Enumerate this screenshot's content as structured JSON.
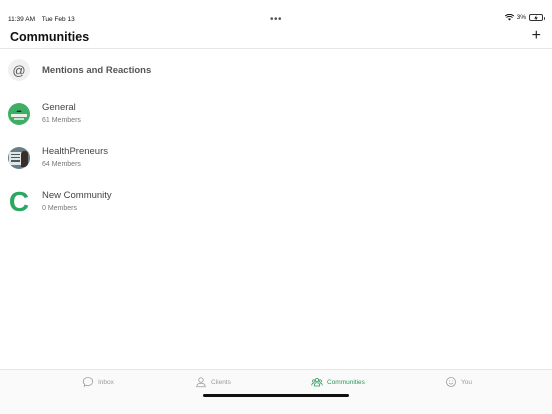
{
  "status_bar": {
    "time": "11:39 AM",
    "date": "Tue Feb 13",
    "dots": "•••",
    "battery": "3%"
  },
  "header": {
    "title": "Communities",
    "add_label": "+"
  },
  "communities": [
    {
      "name": "Mentions and Reactions",
      "members": ""
    },
    {
      "name": "General",
      "members": "61 Members"
    },
    {
      "name": "HealthPreneurs",
      "members": "64 Members"
    },
    {
      "name": "New Community",
      "members": "0 Members",
      "avatar_letter": "C"
    }
  ],
  "mentions_symbol": "@",
  "tabs": [
    {
      "label": "Inbox",
      "icon": "chat-bubble-icon",
      "active": false
    },
    {
      "label": "Clients",
      "icon": "person-icon",
      "active": false
    },
    {
      "label": "Communities",
      "icon": "group-icon",
      "active": true
    },
    {
      "label": "You",
      "icon": "smiley-icon",
      "active": false
    }
  ],
  "colors": {
    "accent": "#2a9a58",
    "inactive_tab": "#9a9a9a"
  }
}
